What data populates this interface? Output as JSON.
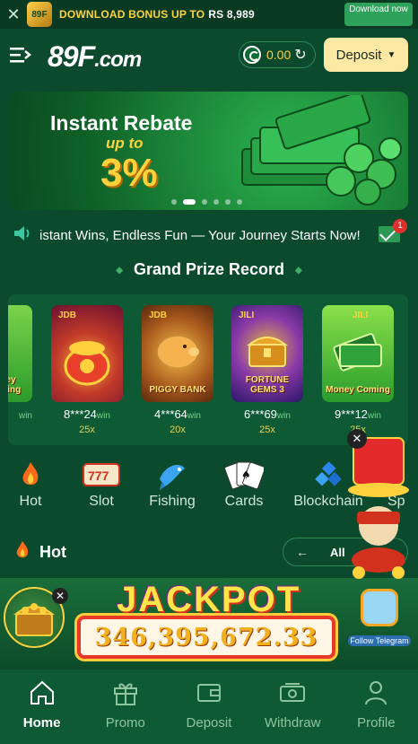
{
  "download_bar": {
    "logo_text": "89F",
    "text": "DOWNLOAD BONUS UP TO",
    "amount": "RS 8,989",
    "button_label": "Download now"
  },
  "header": {
    "brand": "89F",
    "brand_suffix": ".com",
    "balance": "0.00",
    "deposit_label": "Deposit"
  },
  "banner": {
    "line1": "Instant Rebate",
    "line2": "up to",
    "line3": "3%",
    "active_slide": 2,
    "slide_count": 6
  },
  "marquee": {
    "text": "istant Wins, Endless Fun — Your Journey Starts Now!",
    "mail_badge": "1"
  },
  "grand_prize": {
    "title": "Grand Prize Record",
    "records": [
      {
        "user": "",
        "mult": "",
        "game": "Money Coming",
        "logo": ""
      },
      {
        "user": "8***24",
        "mult": "25x",
        "game": "",
        "logo": "JDB"
      },
      {
        "user": "4***64",
        "mult": "20x",
        "game": "PIGGY BANK",
        "logo": "JDB"
      },
      {
        "user": "6***69",
        "mult": "25x",
        "game": "FORTUNE GEMS 3",
        "logo": "JILI"
      },
      {
        "user": "9***12",
        "mult": "25x",
        "game": "Money Coming",
        "logo": "JILI"
      }
    ],
    "win_label": "win",
    "card0_win": "win"
  },
  "categories": [
    {
      "label": "Hot",
      "icon": "flame-icon"
    },
    {
      "label": "Slot",
      "icon": "slot-icon"
    },
    {
      "label": "Fishing",
      "icon": "fish-icon"
    },
    {
      "label": "Cards",
      "icon": "cards-icon"
    },
    {
      "label": "Blockchain",
      "icon": "blockchain-icon"
    },
    {
      "label": "Sp",
      "icon": "sports-icon"
    }
  ],
  "hot_section": {
    "title": "Hot",
    "all_label": "All"
  },
  "jackpot": {
    "title": "JACKPOT",
    "amount": "346,395,672.33",
    "telegram_label": "Follow Telegram"
  },
  "bottom_nav": [
    {
      "label": "Home",
      "icon": "home-icon",
      "active": true
    },
    {
      "label": "Promo",
      "icon": "gift-icon",
      "active": false
    },
    {
      "label": "Deposit",
      "icon": "wallet-icon",
      "active": false
    },
    {
      "label": "Withdraw",
      "icon": "withdraw-icon",
      "active": false
    },
    {
      "label": "Profile",
      "icon": "profile-icon",
      "active": false
    }
  ],
  "colors": {
    "background": "#0b4a2c",
    "accent_yellow": "#ffd33d",
    "deposit_button": "#fde9a4",
    "download_button": "#2ea15a",
    "badge_red": "#e0302d"
  }
}
